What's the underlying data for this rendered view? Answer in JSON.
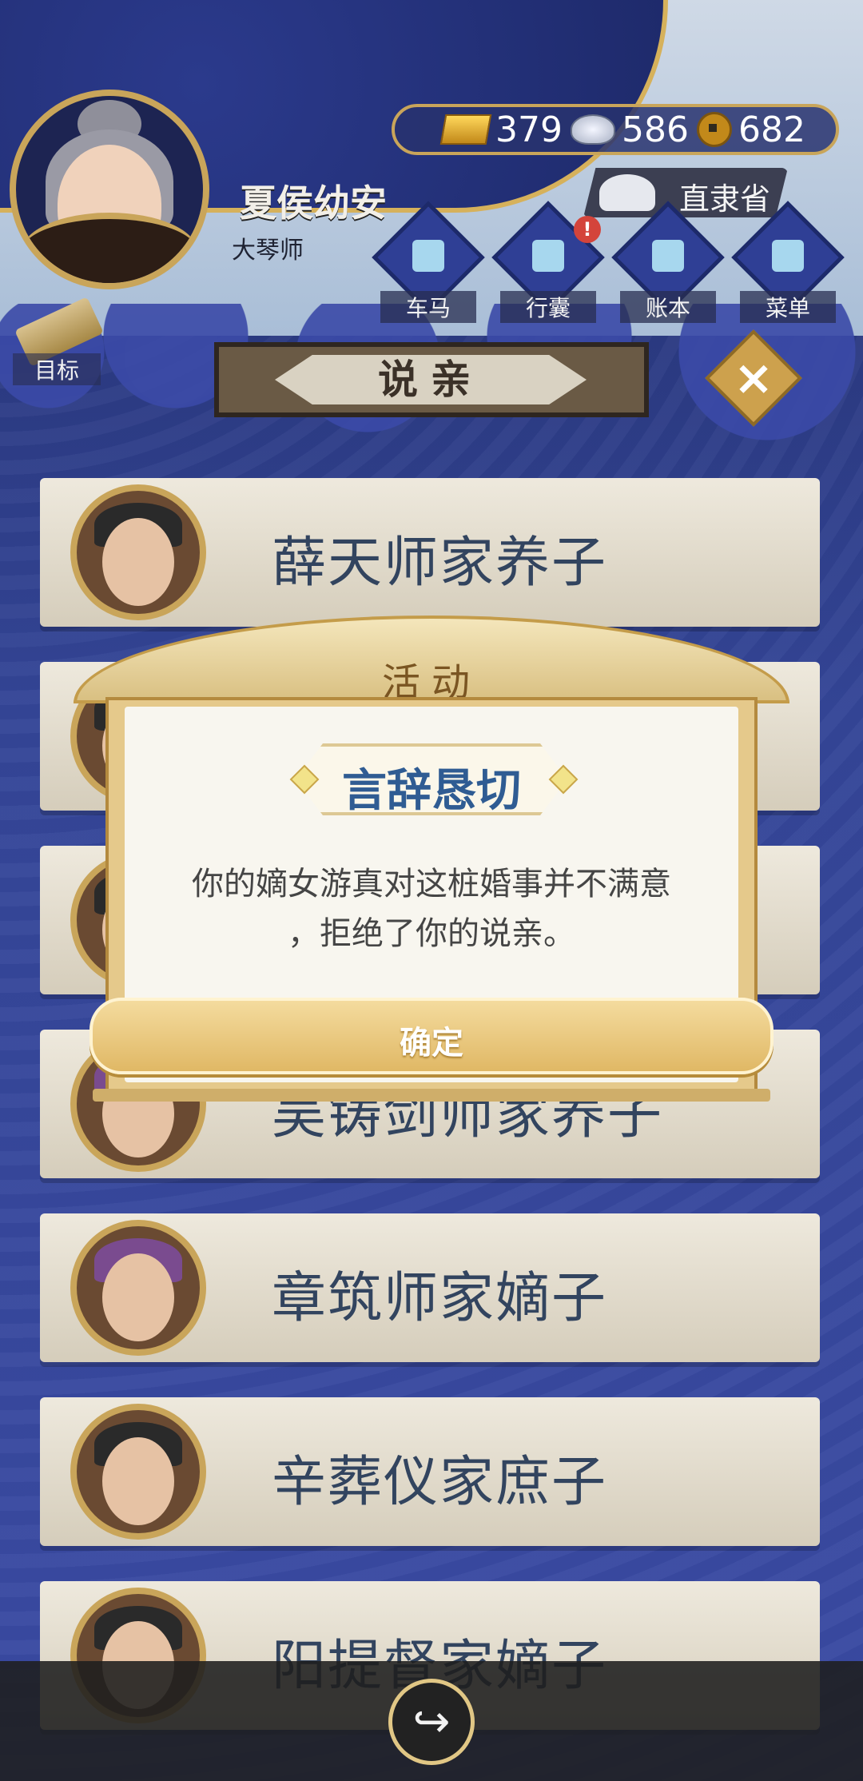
{
  "player": {
    "name": "夏侯幼安",
    "title": "大琴师"
  },
  "currency": {
    "gold": "379",
    "silver": "586",
    "coins": "682"
  },
  "location": {
    "label": "直隶省"
  },
  "nav": [
    {
      "label": "车马",
      "icon": "carriage-icon"
    },
    {
      "label": "行囊",
      "icon": "bag-icon",
      "alert": "!"
    },
    {
      "label": "账本",
      "icon": "ledger-icon"
    },
    {
      "label": "菜单",
      "icon": "menu-icon"
    }
  ],
  "goal": {
    "label": "目标"
  },
  "page_title": "说亲",
  "close_glyph": "×",
  "list": [
    {
      "name": "薛天师家养子"
    },
    {
      "name": ""
    },
    {
      "name": ""
    },
    {
      "name": "吴铸剑师家养子"
    },
    {
      "name": "章筑师家嫡子"
    },
    {
      "name": "辛葬仪家庶子"
    },
    {
      "name": "阳提督家嫡子"
    }
  ],
  "modal": {
    "title": "活动",
    "subtitle": "言辞恳切",
    "message_line1": "你的嫡女游真对这桩婚事并不满意",
    "message_line2": "，拒绝了你的说亲。",
    "confirm": "确定"
  },
  "share": {
    "glyph": "↪"
  }
}
